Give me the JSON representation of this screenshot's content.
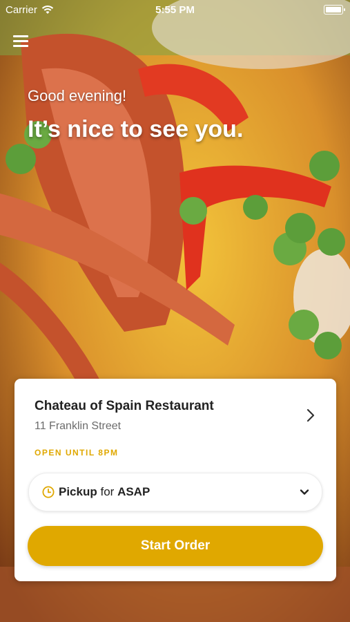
{
  "status_bar": {
    "carrier": "Carrier",
    "time": "5:55 PM"
  },
  "hero": {
    "greeting": "Good evening!",
    "headline": "It’s nice to see you."
  },
  "restaurant": {
    "name": "Chateau of Spain Restaurant",
    "address": "11 Franklin Street",
    "hours": "OPEN UNTIL 8PM"
  },
  "order_mode": {
    "mode": "Pickup",
    "connector": "for",
    "time": "ASAP"
  },
  "actions": {
    "start_label": "Start Order"
  },
  "colors": {
    "accent": "#e0a800",
    "card": "#ffffff"
  }
}
